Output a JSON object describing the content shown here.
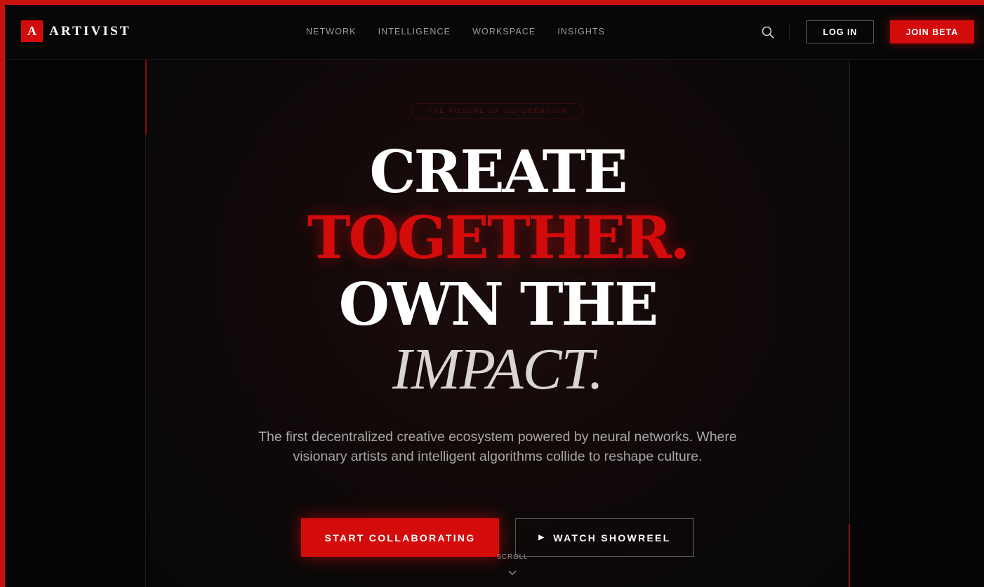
{
  "brand": {
    "mark": "A",
    "name": "ARTIVIST"
  },
  "nav": {
    "links": [
      "NETWORK",
      "INTELLIGENCE",
      "WORKSPACE",
      "INSIGHTS"
    ],
    "search_icon": "search-icon",
    "login_label": "LOG IN",
    "join_label": "JOIN BETA"
  },
  "hero": {
    "eyebrow": "THE FUTURE OF CO-CREATION",
    "headline": {
      "line1": "CREATE",
      "line2": "TOGETHER.",
      "line3": "OWN THE",
      "line4": "IMPACT."
    },
    "subtitle": "The first decentralized creative ecosystem powered by neural networks. Where visionary artists and intelligent algorithms collide to reshape culture.",
    "primary_cta": "START COLLABORATING",
    "secondary_cta": "WATCH SHOWREEL",
    "scroll_label": "SCROLL"
  },
  "colors": {
    "accent": "#d40b0b",
    "background": "#050505",
    "frame": "#c8100e"
  }
}
